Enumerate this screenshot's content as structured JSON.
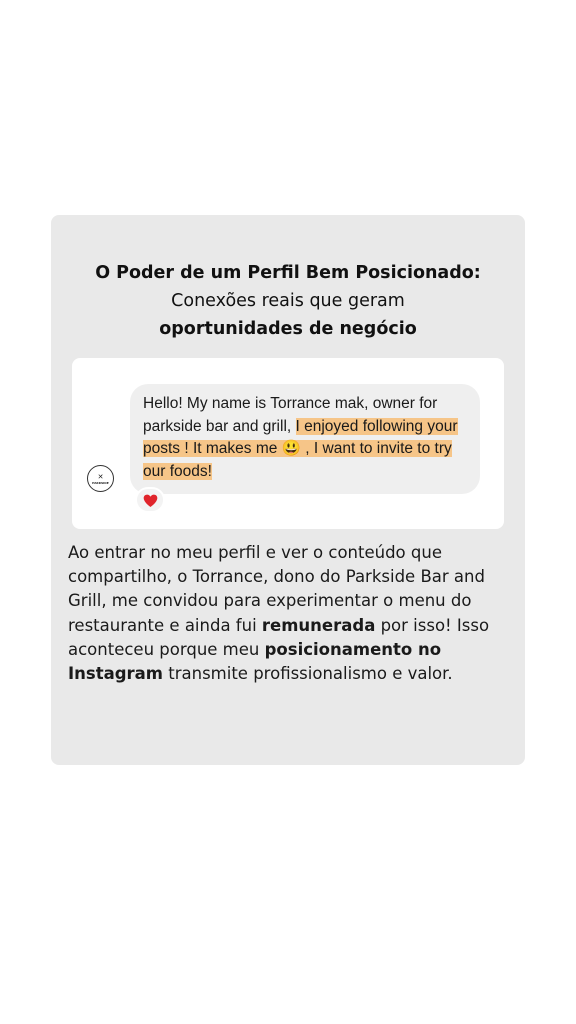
{
  "header": {
    "title_bold": "O Poder de um Perfil Bem Posicionado:",
    "subtitle_line1": "Conexões reais que geram",
    "subtitle_line2_bold": "oportunidades de negócio"
  },
  "chat": {
    "avatar_logo_text": "PARKSIDE",
    "message_plain": "Hello! My name is Torrance mak, owner for parkside bar and grill, ",
    "message_highlight_1": "I enjoyed following your posts ! It makes me ",
    "emoji": "😃",
    "message_highlight_2": " , I want to invite to try our foods!",
    "reaction": "❤️",
    "reaction_color": "#e0242b",
    "highlight_color": "#f6c588"
  },
  "description": {
    "part1": "Ao entrar no meu perfil e ver o conteúdo que compartilho, o Torrance, dono do Parkside Bar and Grill, me convidou para experimentar o menu do restaurante e ainda fui ",
    "bold1": "remunerada",
    "part2": " por isso! Isso aconteceu porque meu ",
    "bold2": "posicionamento no Instagram",
    "part3": " transmite profissionalismo e valor."
  }
}
